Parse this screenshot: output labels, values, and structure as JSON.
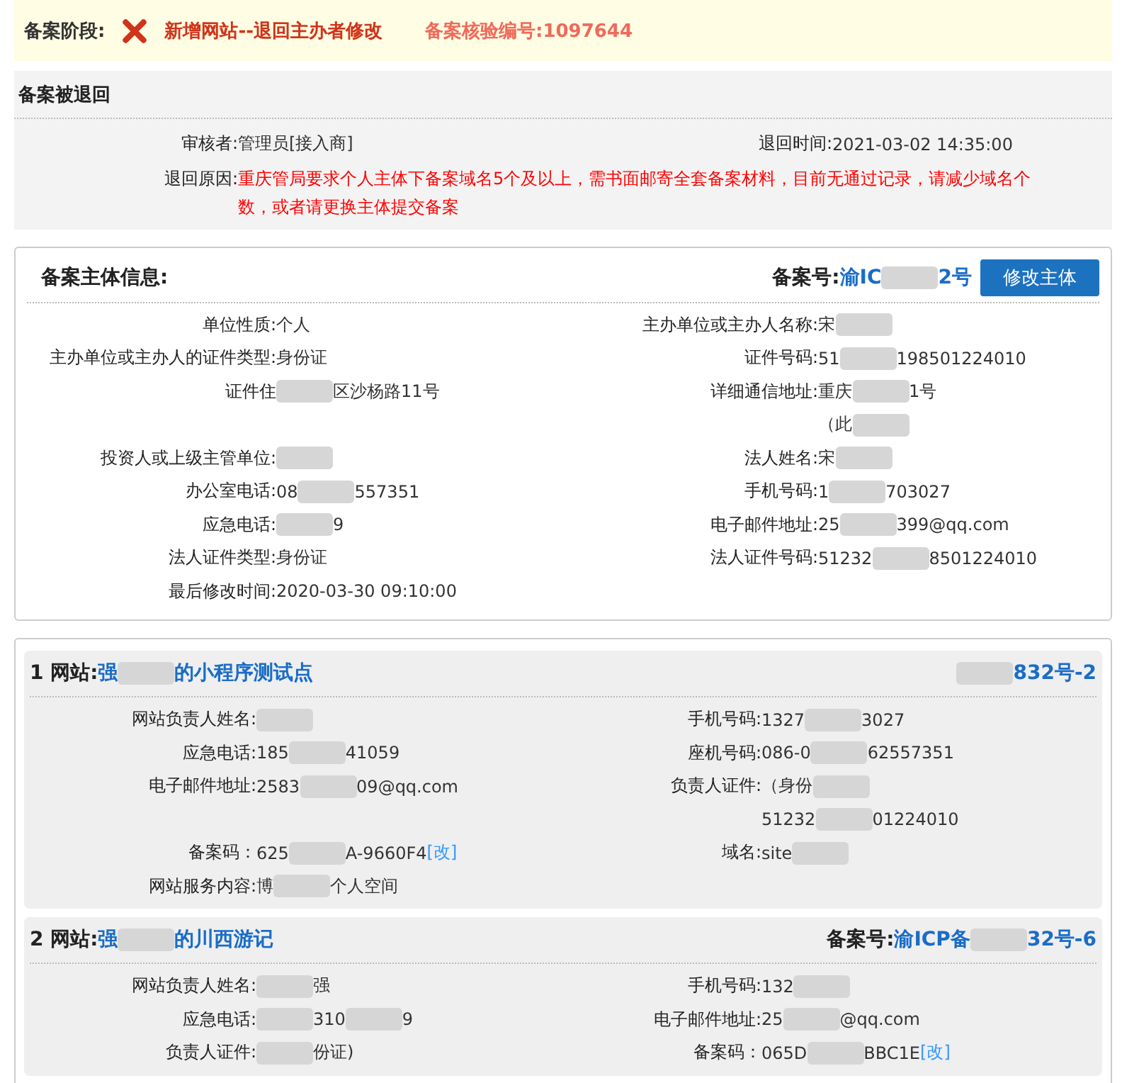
{
  "stage_bar": {
    "label": "备案阶段:",
    "status": "新增网站--退回主办者修改",
    "check_number": "备案核验编号:1097644"
  },
  "return_panel": {
    "title": "备案被退回",
    "reviewer": {
      "label": "审核者:",
      "value": "管理员[接入商]"
    },
    "return_time": {
      "label": "退回时间:",
      "value": "2021-03-02 14:35:00"
    },
    "reason": {
      "label": "退回原因:",
      "value": "重庆管局要求个人主体下备案域名5个及以上，需书面邮寄全套备案材料，目前无通过记录，请减少域名个数，或者请更换主体提交备案"
    }
  },
  "subject": {
    "title": "备案主体信息:",
    "record_number": [
      {
        "kind": "label",
        "text": "备案号:"
      },
      {
        "kind": "text",
        "text": "渝IC"
      },
      {
        "kind": "blur"
      },
      {
        "kind": "text",
        "text": "2号"
      }
    ],
    "edit_button": "修改主体",
    "rows": [
      {
        "left": {
          "label": "单位性质:",
          "value": [
            {
              "kind": "text",
              "text": "个人"
            }
          ]
        },
        "right": {
          "label": "主办单位或主办人名称:",
          "value": [
            {
              "kind": "text",
              "text": "宋"
            },
            {
              "kind": "blur"
            }
          ]
        }
      },
      {
        "left": {
          "label": "主办单位或主办人的证件类型:",
          "value": [
            {
              "kind": "text",
              "text": "身份证"
            }
          ]
        },
        "right": {
          "label": "证件号码:",
          "value": [
            {
              "kind": "text",
              "text": "51"
            },
            {
              "kind": "blur"
            },
            {
              "kind": "text",
              "text": "198501224010"
            }
          ]
        }
      },
      {
        "left": {
          "label": "证件住",
          "value": [
            {
              "kind": "blur"
            },
            {
              "kind": "text",
              "text": "区沙杨路11号"
            }
          ]
        },
        "right": {
          "label": "详细通信地址:",
          "value": [
            {
              "kind": "text",
              "text": "重庆"
            },
            {
              "kind": "blur"
            },
            {
              "kind": "text",
              "text": "1号"
            }
          ]
        }
      },
      {
        "right": {
          "value": [
            {
              "kind": "text",
              "text": "（此"
            },
            {
              "kind": "blur"
            }
          ]
        }
      },
      {
        "left": {
          "label": "投资人或上级主管单位:",
          "value": [
            {
              "kind": "blur"
            }
          ]
        },
        "right": {
          "label": "法人姓名:",
          "value": [
            {
              "kind": "text",
              "text": "宋"
            },
            {
              "kind": "blur"
            }
          ]
        }
      },
      {
        "left": {
          "label": "办公室电话:",
          "value": [
            {
              "kind": "text",
              "text": "08"
            },
            {
              "kind": "blur"
            },
            {
              "kind": "text",
              "text": "557351"
            }
          ]
        },
        "right": {
          "label": "手机号码:",
          "value": [
            {
              "kind": "text",
              "text": "1"
            },
            {
              "kind": "blur"
            },
            {
              "kind": "text",
              "text": "703027"
            }
          ]
        }
      },
      {
        "left": {
          "label": "应急电话:",
          "value": [
            {
              "kind": "blur"
            },
            {
              "kind": "text",
              "text": "9"
            }
          ]
        },
        "right": {
          "label": "电子邮件地址:",
          "value": [
            {
              "kind": "text",
              "text": "25"
            },
            {
              "kind": "blur"
            },
            {
              "kind": "text",
              "text": "399@qq.com"
            }
          ]
        }
      },
      {
        "left": {
          "label": "法人证件类型:",
          "value": [
            {
              "kind": "text",
              "text": "身份证"
            }
          ]
        },
        "right": {
          "label": "法人证件号码:",
          "value": [
            {
              "kind": "text",
              "text": "51232"
            },
            {
              "kind": "blur"
            },
            {
              "kind": "text",
              "text": "8501224010"
            }
          ]
        }
      },
      {
        "left": {
          "label": "最后修改时间:",
          "value": [
            {
              "kind": "text",
              "text": "2020-03-30 09:10:00"
            }
          ]
        }
      }
    ]
  },
  "sites": [
    {
      "heading": "1 网站:",
      "name": [
        {
          "kind": "text",
          "text": "强"
        },
        {
          "kind": "blur"
        },
        {
          "kind": "text",
          "text": "的小程序测试点"
        }
      ],
      "record_number": [
        {
          "kind": "blur"
        },
        {
          "kind": "text",
          "text": "832号-2"
        }
      ],
      "rows": [
        {
          "left": {
            "label": "网站负责人姓名:",
            "value": [
              {
                "kind": "blur"
              }
            ]
          },
          "right": {
            "label": "手机号码:",
            "value": [
              {
                "kind": "text",
                "text": "1327"
              },
              {
                "kind": "blur"
              },
              {
                "kind": "text",
                "text": "3027"
              }
            ]
          }
        },
        {
          "left": {
            "label": "应急电话:",
            "value": [
              {
                "kind": "text",
                "text": "185"
              },
              {
                "kind": "blur"
              },
              {
                "kind": "text",
                "text": "41059"
              }
            ]
          },
          "right": {
            "label": "座机号码:",
            "value": [
              {
                "kind": "text",
                "text": "086-0"
              },
              {
                "kind": "blur"
              },
              {
                "kind": "text",
                "text": "62557351"
              }
            ]
          }
        },
        {
          "left": {
            "label": "电子邮件地址:",
            "value": [
              {
                "kind": "text",
                "text": "2583"
              },
              {
                "kind": "blur"
              },
              {
                "kind": "text",
                "text": "09@qq.com"
              }
            ]
          },
          "right": {
            "label": "负责人证件:",
            "value": [
              {
                "kind": "text",
                "text": "（身份"
              },
              {
                "kind": "blur"
              }
            ]
          }
        },
        {
          "right": {
            "value": [
              {
                "kind": "text",
                "text": "51232"
              },
              {
                "kind": "blur"
              },
              {
                "kind": "text",
                "text": "01224010"
              }
            ]
          }
        },
        {
          "left": {
            "label": "备案码：",
            "value": [
              {
                "kind": "text",
                "text": "625"
              },
              {
                "kind": "blur"
              },
              {
                "kind": "text",
                "text": "A-9660F4"
              },
              {
                "kind": "link",
                "text": "[改]"
              }
            ]
          },
          "right": {
            "label": "域名:",
            "value": [
              {
                "kind": "text",
                "text": "site"
              },
              {
                "kind": "blur"
              }
            ]
          }
        },
        {
          "left": {
            "label": "网站服务内容:",
            "value": [
              {
                "kind": "text",
                "text": "博"
              },
              {
                "kind": "blur"
              },
              {
                "kind": "text",
                "text": "个人空间"
              }
            ]
          }
        }
      ]
    },
    {
      "heading": "2 网站:",
      "name": [
        {
          "kind": "text",
          "text": "强"
        },
        {
          "kind": "blur"
        },
        {
          "kind": "text",
          "text": "的川西游记"
        }
      ],
      "record_number": [
        {
          "kind": "label",
          "text": "备案号:"
        },
        {
          "kind": "text",
          "text": "渝ICP备"
        },
        {
          "kind": "blur"
        },
        {
          "kind": "text",
          "text": "32号-6"
        }
      ],
      "rows": [
        {
          "left": {
            "label": "网站负责人姓名:",
            "value": [
              {
                "kind": "blur"
              },
              {
                "kind": "text",
                "text": "强"
              }
            ]
          },
          "right": {
            "label": "手机号码:",
            "value": [
              {
                "kind": "text",
                "text": "132"
              },
              {
                "kind": "blur"
              }
            ]
          }
        },
        {
          "left": {
            "label": "应急电话:",
            "value": [
              {
                "kind": "blur"
              },
              {
                "kind": "text",
                "text": "310"
              },
              {
                "kind": "blur"
              },
              {
                "kind": "text",
                "text": "9"
              }
            ]
          },
          "right": {
            "label": "电子邮件地址:",
            "value": [
              {
                "kind": "text",
                "text": "25"
              },
              {
                "kind": "blur"
              },
              {
                "kind": "text",
                "text": "@qq.com"
              }
            ]
          }
        },
        {
          "left": {
            "label": "负责人证件:",
            "value": [
              {
                "kind": "blur"
              },
              {
                "kind": "text",
                "text": "份证)"
              }
            ]
          },
          "right": {
            "label": "备案码：",
            "value": [
              {
                "kind": "text",
                "text": "065D"
              },
              {
                "kind": "blur"
              },
              {
                "kind": "text",
                "text": "BBC1E"
              },
              {
                "kind": "link",
                "text": "[改]"
              }
            ]
          }
        }
      ]
    }
  ]
}
